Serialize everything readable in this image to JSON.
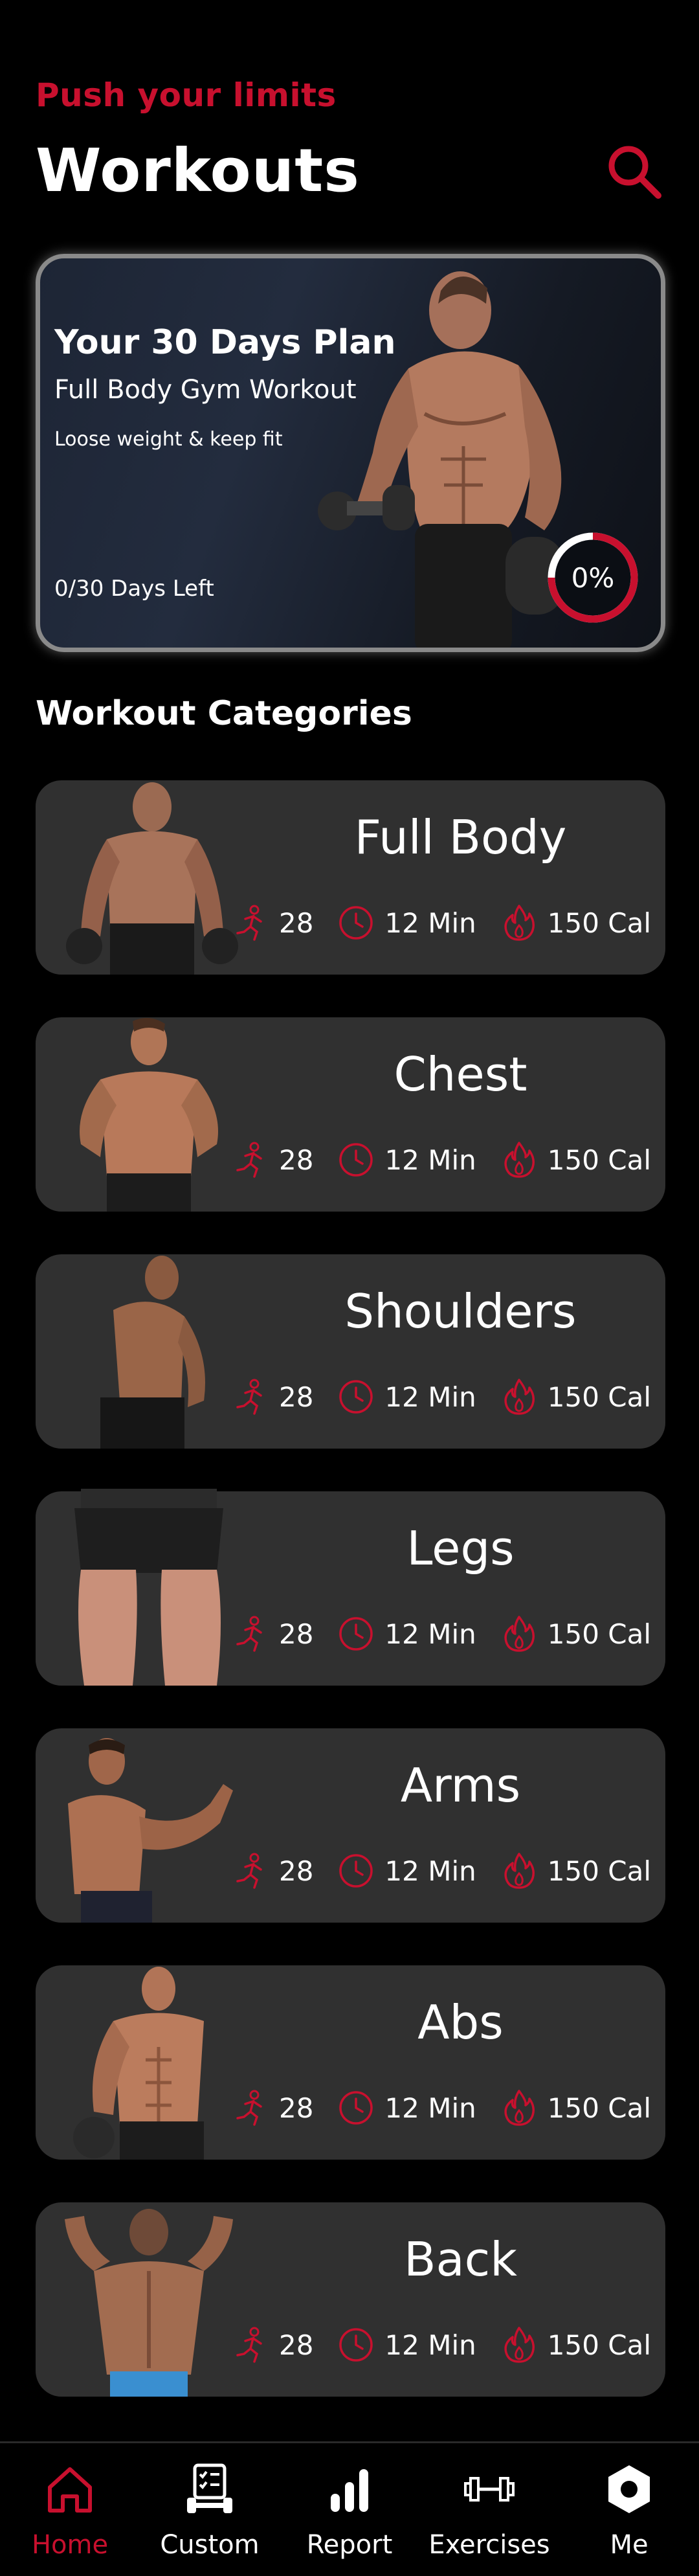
{
  "header": {
    "tagline": "Push your limits",
    "title": "Workouts"
  },
  "plan": {
    "title": "Your 30 Days Plan",
    "subtitle": "Full Body Gym Workout",
    "description": "Loose weight & keep fit",
    "days_left": "0/30 Days Left",
    "progress_text": "0%",
    "progress": 0
  },
  "section_title": "Workout Categories",
  "categories": [
    {
      "name": "Full Body",
      "exercises": "28",
      "time": "12 Min",
      "calories": "150 Cal"
    },
    {
      "name": "Chest",
      "exercises": "28",
      "time": "12 Min",
      "calories": "150 Cal"
    },
    {
      "name": "Shoulders",
      "exercises": "28",
      "time": "12 Min",
      "calories": "150 Cal"
    },
    {
      "name": "Legs",
      "exercises": "28",
      "time": "12 Min",
      "calories": "150 Cal"
    },
    {
      "name": "Arms",
      "exercises": "28",
      "time": "12 Min",
      "calories": "150 Cal"
    },
    {
      "name": "Abs",
      "exercises": "28",
      "time": "12 Min",
      "calories": "150 Cal"
    },
    {
      "name": "Back",
      "exercises": "28",
      "time": "12 Min",
      "calories": "150 Cal"
    }
  ],
  "nav": {
    "items": [
      {
        "label": "Home",
        "icon": "home-icon",
        "active": true
      },
      {
        "label": "Custom",
        "icon": "custom-icon",
        "active": false
      },
      {
        "label": "Report",
        "icon": "report-icon",
        "active": false
      },
      {
        "label": "Exercises",
        "icon": "dumbbell-icon",
        "active": false
      },
      {
        "label": "Me",
        "icon": "settings-icon",
        "active": false
      }
    ]
  },
  "colors": {
    "accent": "#c8102e",
    "card": "#303030",
    "background": "#000000"
  }
}
